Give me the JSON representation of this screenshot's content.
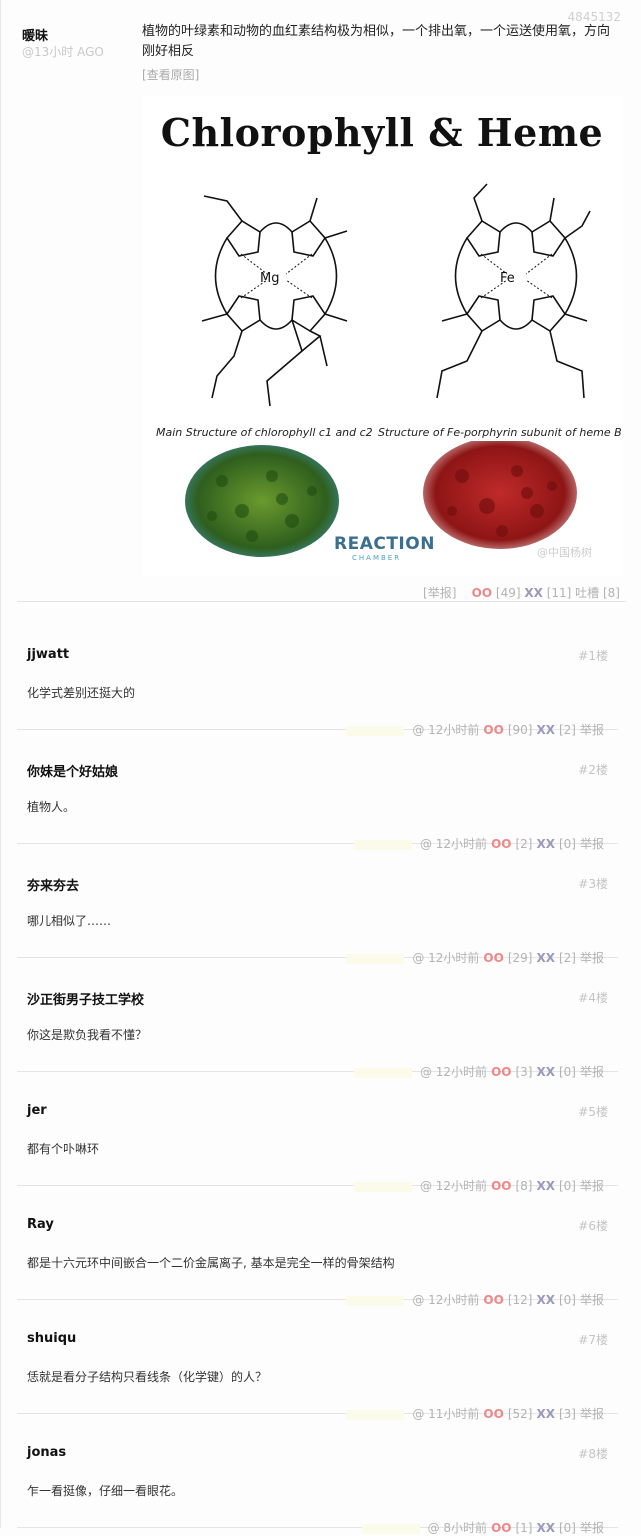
{
  "post": {
    "id": "4845132",
    "author": "暖昧",
    "time": "@13小时 AGO",
    "text": "植物的叶绿素和动物的血红素结构极为相似，一个排出氧，一个运送使用氧，方向刚好相反",
    "view_original": "[查看原图]",
    "figure": {
      "title": "Chlorophyll & Heme",
      "caption_left": "Main Structure of chlorophyll c1 and c2",
      "caption_right": "Structure of Fe-porphyrin subunit of heme B",
      "brand": "REACTION",
      "brand_sub": "CHAMBER",
      "watermark": "@中国杨树",
      "mg_label": "Mg",
      "fe_label": "Fe"
    },
    "actions": {
      "report": "[举报]",
      "oo": "OO",
      "oo_count": "[49]",
      "xx": "XX",
      "xx_count": "[11]",
      "tucao": "吐槽 [8]"
    }
  },
  "comments": [
    {
      "author": "jjwatt",
      "floor": "#1楼",
      "text": "化学式差别还挺大的",
      "time": "@  12小时前",
      "oo": "OO",
      "oo_count": "[90]",
      "xx": "XX",
      "xx_count": "[2]",
      "report": "举报"
    },
    {
      "author": "你妹是个好姑娘",
      "floor": "#2楼",
      "text": "植物人。",
      "time": "@  12小时前",
      "oo": "OO",
      "oo_count": "[2]",
      "xx": "XX",
      "xx_count": "[0]",
      "report": "举报"
    },
    {
      "author": "夯来夯去",
      "floor": "#3楼",
      "text": "哪儿相似了……",
      "time": "@  12小时前",
      "oo": "OO",
      "oo_count": "[29]",
      "xx": "XX",
      "xx_count": "[2]",
      "report": "举报"
    },
    {
      "author": "沙正街男子技工学校",
      "floor": "#4楼",
      "text": "你这是欺负我看不懂？",
      "time": "@  12小时前",
      "oo": "OO",
      "oo_count": "[3]",
      "xx": "XX",
      "xx_count": "[0]",
      "report": "举报"
    },
    {
      "author": "jer",
      "floor": "#5楼",
      "text": "都有个卟啉环",
      "time": "@  12小时前",
      "oo": "OO",
      "oo_count": "[8]",
      "xx": "XX",
      "xx_count": "[0]",
      "report": "举报"
    },
    {
      "author": "Ray",
      "floor": "#6楼",
      "text": "都是十六元环中间嵌合一个二价金属离子, 基本是完全一样的骨架结构",
      "time": "@  12小时前",
      "oo": "OO",
      "oo_count": "[12]",
      "xx": "XX",
      "xx_count": "[0]",
      "report": "举报"
    },
    {
      "author": "shuiqu",
      "floor": "#7楼",
      "text": "恁就是看分子结构只看线条（化学键）的人？",
      "time": "@  11小时前",
      "oo": "OO",
      "oo_count": "[52]",
      "xx": "XX",
      "xx_count": "[3]",
      "report": "举报"
    },
    {
      "author": "jonas",
      "floor": "#8楼",
      "text": "乍一看挺像，仔细一看眼花。",
      "time": "@  8小时前",
      "oo": "OO",
      "oo_count": "[1]",
      "xx": "XX",
      "xx_count": "[0]",
      "report": "举报"
    }
  ],
  "colors": {
    "oo": "#ee8888",
    "xx": "#9999bb",
    "brand": "#3a6f8e"
  }
}
